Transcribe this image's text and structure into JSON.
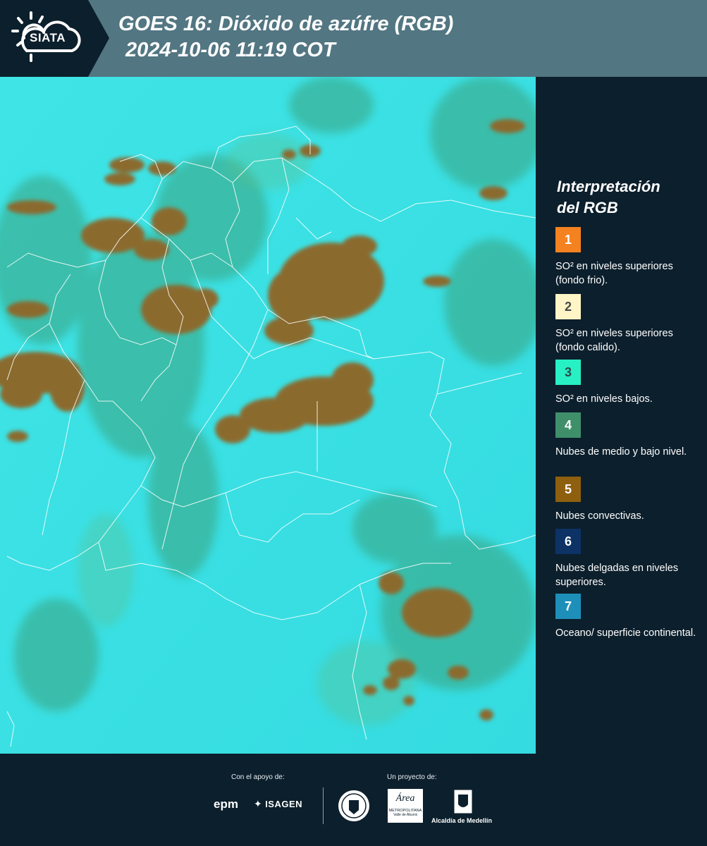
{
  "header": {
    "logo_text": "SIATA",
    "title_line1": "GOES 16: Dióxido de azúfre (RGB)",
    "title_line2": "2024-10-06 11:19 COT"
  },
  "legend": {
    "title_line1": "Interpretación",
    "title_line2": "del RGB",
    "items": [
      {
        "number": "1",
        "color": "#f58220",
        "text_color": "#ffffff",
        "label": "SO² en niveles superiores (fondo frio)."
      },
      {
        "number": "2",
        "color": "#fff5c7",
        "text_color": "#4a4a4a",
        "label": "SO² en niveles superiores (fondo calido)."
      },
      {
        "number": "3",
        "color": "#27f0c5",
        "text_color": "#2d4a4a",
        "label": "SO² en niveles bajos."
      },
      {
        "number": "4",
        "color": "#3f8f6b",
        "text_color": "#ffffff",
        "label": "Nubes de medio y bajo nivel."
      },
      {
        "number": "5",
        "color": "#8e5f0e",
        "text_color": "#ffffff",
        "label": "Nubes convectivas."
      },
      {
        "number": "6",
        "color": "#0d3266",
        "text_color": "#ffffff",
        "label": "Nubes delgadas en niveles superiores."
      },
      {
        "number": "7",
        "color": "#1d8fb8",
        "text_color": "#ffffff",
        "label": "Oceano/ superficie continental."
      }
    ]
  },
  "footer": {
    "support_label": "Con el apoyo de:",
    "project_label": "Un proyecto de:",
    "sponsors": {
      "epm": "epm",
      "isagen": "ISAGEN",
      "area_name": "Área",
      "area_sub": "METROPOLITANA",
      "area_sub2": "Valle de Aburrá",
      "alcaldia": "Alcaldía de Medellín"
    }
  },
  "colors": {
    "background": "#0c1f2c",
    "header_band": "#527682",
    "surface_cyan": "#39e0e2",
    "cloud_brown": "#8b6a2e",
    "cloud_green": "#3aa27e"
  }
}
